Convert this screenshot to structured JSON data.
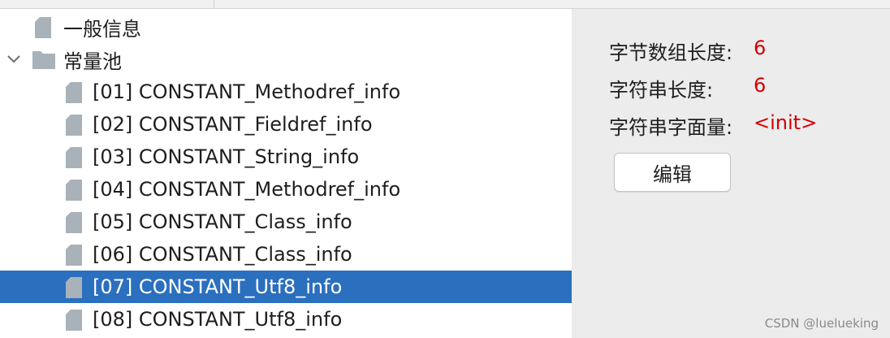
{
  "tree": {
    "general_label": "一般信息",
    "pool_label": "常量池",
    "items": [
      {
        "label": "[01] CONSTANT_Methodref_info"
      },
      {
        "label": "[02] CONSTANT_Fieldref_info"
      },
      {
        "label": "[03] CONSTANT_String_info"
      },
      {
        "label": "[04] CONSTANT_Methodref_info"
      },
      {
        "label": "[05] CONSTANT_Class_info"
      },
      {
        "label": "[06] CONSTANT_Class_info"
      },
      {
        "label": "[07] CONSTANT_Utf8_info"
      },
      {
        "label": "[08] CONSTANT_Utf8_info"
      }
    ],
    "selected_item": "[07] CONSTANT_Utf8_info",
    "icons": {
      "item": "file-icon",
      "folder": "folder-icon",
      "expand": "chevron-down-icon"
    }
  },
  "details": {
    "byte_length_label": "字节数组长度:",
    "byte_length_value": "6",
    "string_length_label": "字符串长度:",
    "string_length_value": "6",
    "literal_label": "字符串字面量:",
    "literal_value": "<init>",
    "edit_button": "编辑"
  },
  "watermark": "CSDN @luelueking",
  "colors": {
    "selection": "#2b6fbf",
    "value": "#d40000",
    "icon": "#a9b1b9"
  }
}
